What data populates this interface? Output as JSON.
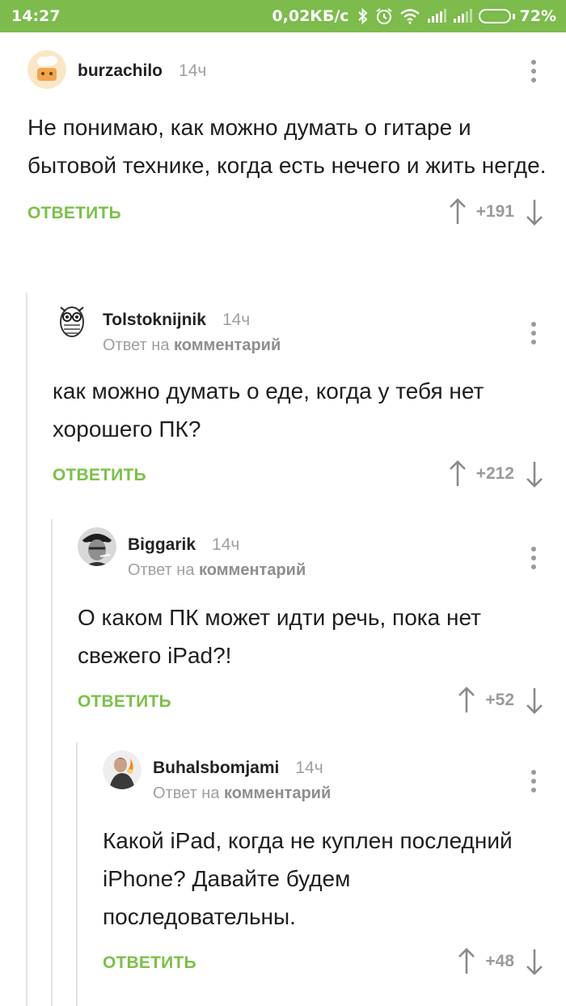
{
  "status_bar": {
    "time": "14:27",
    "net_speed": "0,02КБ/с",
    "battery_percent": "72%",
    "battery_level": 0.72,
    "icons": [
      "bluetooth-icon",
      "alarm-icon",
      "wifi-icon",
      "signal-icon",
      "signal-icon",
      "battery-icon"
    ]
  },
  "colors": {
    "status_bar_bg": "#7dbb4c",
    "reply_green": "#7cc04a",
    "meta_gray": "#a0a0a0",
    "thread_line": "#e3e3e3"
  },
  "comments": [
    {
      "author": "burzachilo",
      "age": "14ч",
      "reply_to": null,
      "text": "Не понимаю, как можно думать о гитаре и бытовой технике, когда есть нечего и жить негде.",
      "reply_label": "ОТВЕТИТЬ",
      "score": "+191"
    },
    {
      "author": "Tolstoknijnik",
      "age": "14ч",
      "reply_to": {
        "prefix": "Ответ на",
        "target": "комментарий"
      },
      "text": "как можно думать о еде, когда у тебя нет хорошего ПК?",
      "reply_label": "ОТВЕТИТЬ",
      "score": "+212"
    },
    {
      "author": "Biggarik",
      "age": "14ч",
      "reply_to": {
        "prefix": "Ответ на",
        "target": "комментарий"
      },
      "text": "О каком ПК может идти речь, пока нет свежего iPad?!",
      "reply_label": "ОТВЕТИТЬ",
      "score": "+52"
    },
    {
      "author": "Buhalsbomjami",
      "age": "14ч",
      "reply_to": {
        "prefix": "Ответ на",
        "target": "комментарий"
      },
      "text": "Какой iPad, когда не куплен последний iPhone? Давайте будем последовательны.",
      "reply_label": "ОТВЕТИТЬ",
      "score": "+48"
    }
  ]
}
